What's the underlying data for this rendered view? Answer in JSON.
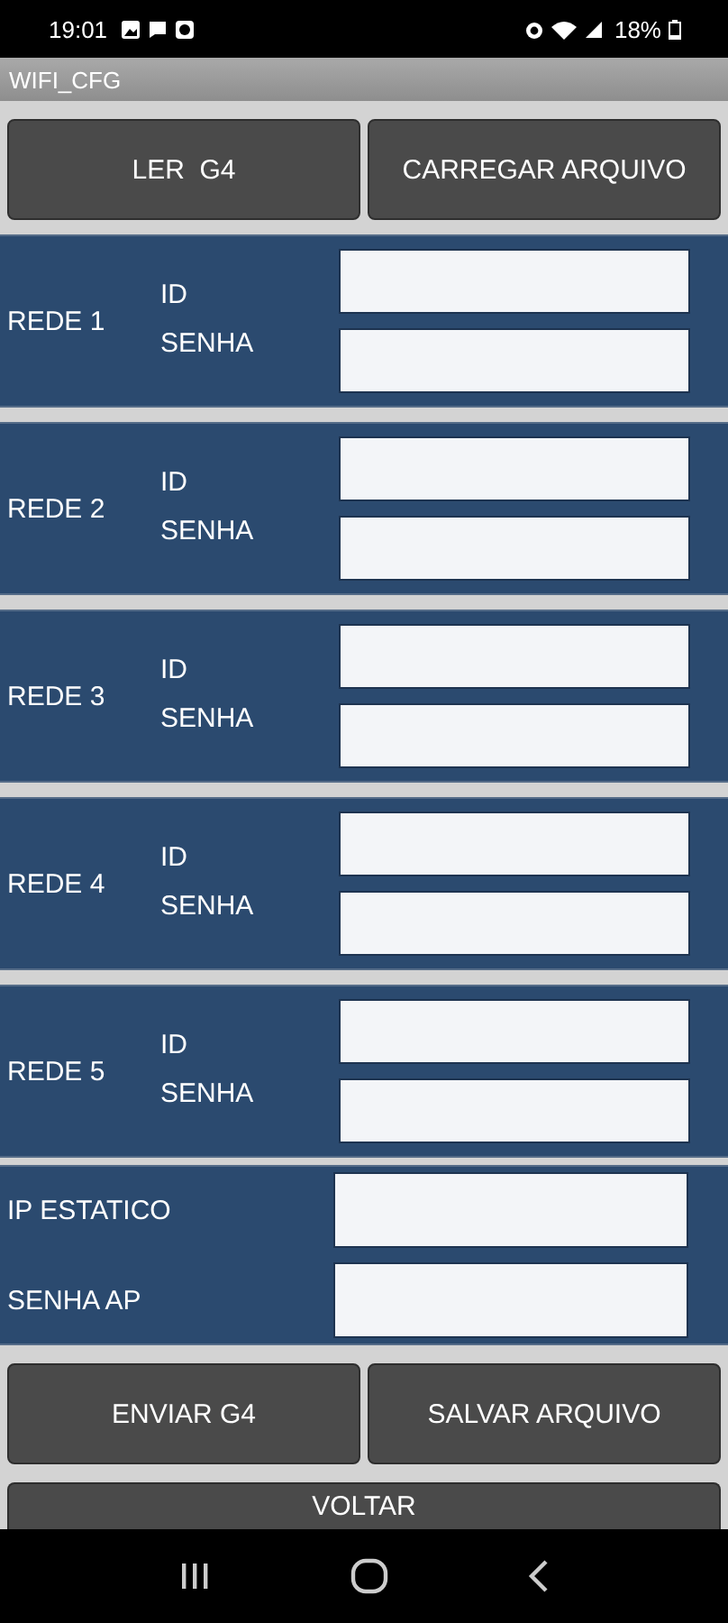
{
  "status_bar": {
    "time": "19:01",
    "battery": "18%"
  },
  "title": "WIFI_CFG",
  "top_buttons": [
    "LER  G4",
    "CARREGAR ARQUIVO"
  ],
  "networks": [
    {
      "name": "REDE 1",
      "fields": [
        {
          "label": "ID"
        },
        {
          "label": "SENHA"
        }
      ]
    },
    {
      "name": "REDE 2",
      "fields": [
        {
          "label": "ID"
        },
        {
          "label": "SENHA"
        }
      ]
    },
    {
      "name": "REDE 3",
      "fields": [
        {
          "label": "ID"
        },
        {
          "label": "SENHA"
        }
      ]
    },
    {
      "name": "REDE 4",
      "fields": [
        {
          "label": "ID"
        },
        {
          "label": "SENHA"
        }
      ]
    },
    {
      "name": "REDE 5",
      "fields": [
        {
          "label": "ID"
        },
        {
          "label": "SENHA"
        }
      ]
    }
  ],
  "extra_fields": [
    {
      "label": "IP ESTATICO"
    },
    {
      "label": "SENHA AP"
    }
  ],
  "bottom_buttons": [
    "ENVIAR G4",
    "SALVAR ARQUIVO"
  ],
  "back_button": "VOLTAR"
}
